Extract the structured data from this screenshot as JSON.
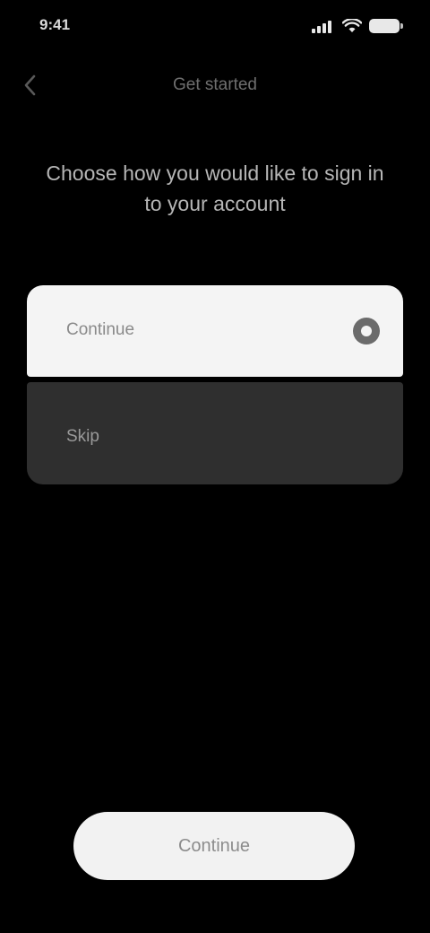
{
  "status_bar": {
    "time": "9:41"
  },
  "nav": {
    "title": "Get started"
  },
  "heading": "Choose how you would like to sign in to your account",
  "options": [
    {
      "label": "Continue",
      "selected": true
    },
    {
      "label": "Skip",
      "selected": false
    }
  ],
  "continue_button": {
    "label": "Continue"
  },
  "colors": {
    "background": "#000000",
    "card_selected": "#f4f4f4",
    "card_unselected": "#2f2f2f",
    "button": "#f2f2f2"
  },
  "icons": {
    "back": "chevron-left-icon",
    "signal": "signal-icon",
    "wifi": "wifi-icon",
    "battery": "battery-icon",
    "radio": "radio-selected-icon"
  }
}
